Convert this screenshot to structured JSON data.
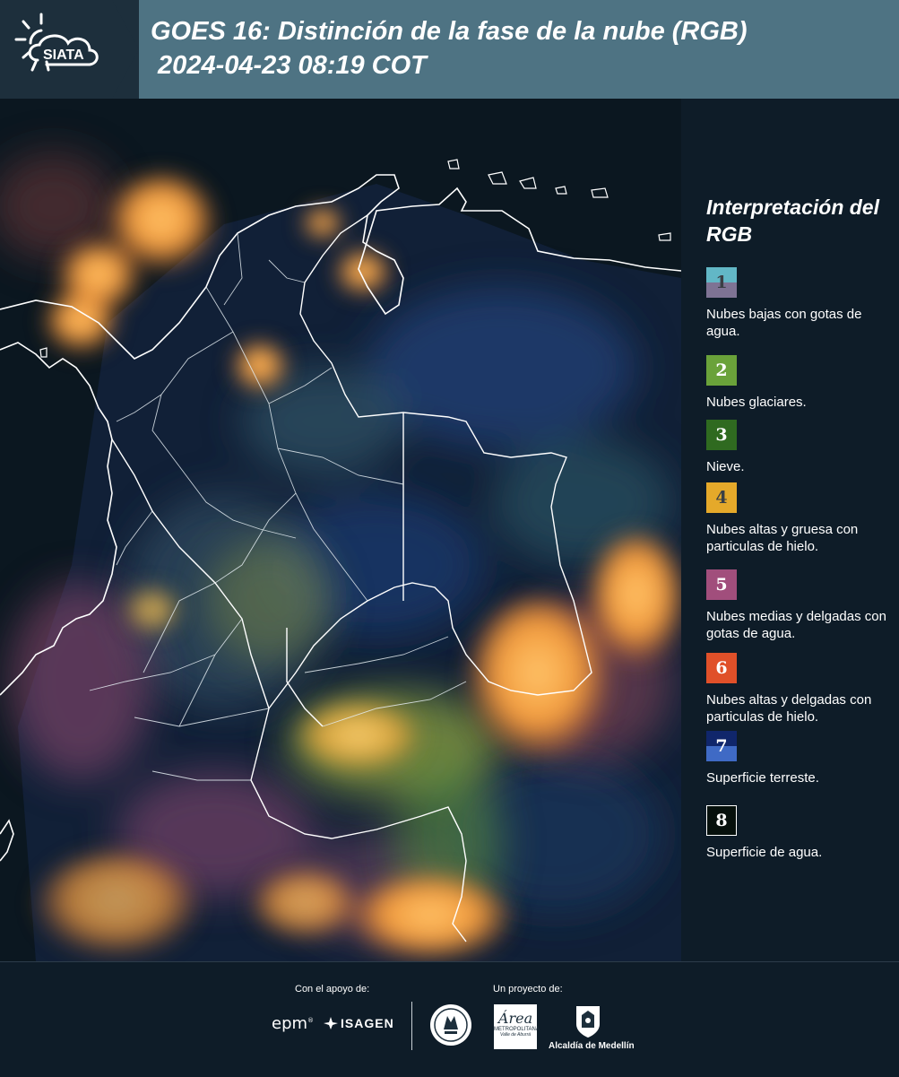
{
  "header": {
    "logo_text": "SIATA",
    "title_line1": "GOES 16: Distinción de la fase de la nube (RGB)",
    "title_line2": " 2024-04-23 08:19 COT"
  },
  "legend": {
    "title": "Interpretación del RGB",
    "items": [
      {
        "num": "1",
        "label": "Nubes bajas con gotas de agua.",
        "colors": [
          "#62b7c6",
          "#7e7394"
        ]
      },
      {
        "num": "2",
        "label": "Nubes glaciares.",
        "colors": [
          "#6aa23a"
        ]
      },
      {
        "num": "3",
        "label": "Nieve.",
        "colors": [
          "#2f6a20"
        ]
      },
      {
        "num": "4",
        "label": "Nubes altas y gruesa con particulas de hielo.",
        "colors": [
          "#e5a92a"
        ]
      },
      {
        "num": "5",
        "label": "Nubes medias y delgadas con gotas de agua.",
        "colors": [
          "#a14e7c"
        ]
      },
      {
        "num": "6",
        "label": "Nubes altas y delgadas con particulas de hielo.",
        "colors": [
          "#e05029"
        ]
      },
      {
        "num": "7",
        "label": "Superficie terreste.",
        "colors": [
          "#10266b",
          "#3f6ac5"
        ]
      },
      {
        "num": "8",
        "label": "Superficie de agua.",
        "colors": [
          "#06100c"
        ]
      }
    ]
  },
  "footer": {
    "support_label": "Con el apoyo de:",
    "project_label": "Un proyecto de:",
    "sponsor_epm": "epm",
    "sponsor_isagen": "ISAGEN",
    "partner_area": "Área",
    "partner_area_sub": "METROPOLITANA",
    "partner_area_sub2": "Valle de Aburrá",
    "partner_alcaldia": "Alcaldía de Medellín"
  },
  "colors": {
    "header_bg": "#4e7383",
    "logo_bg": "#1d2f3c",
    "page_bg": "#0e1c28"
  }
}
